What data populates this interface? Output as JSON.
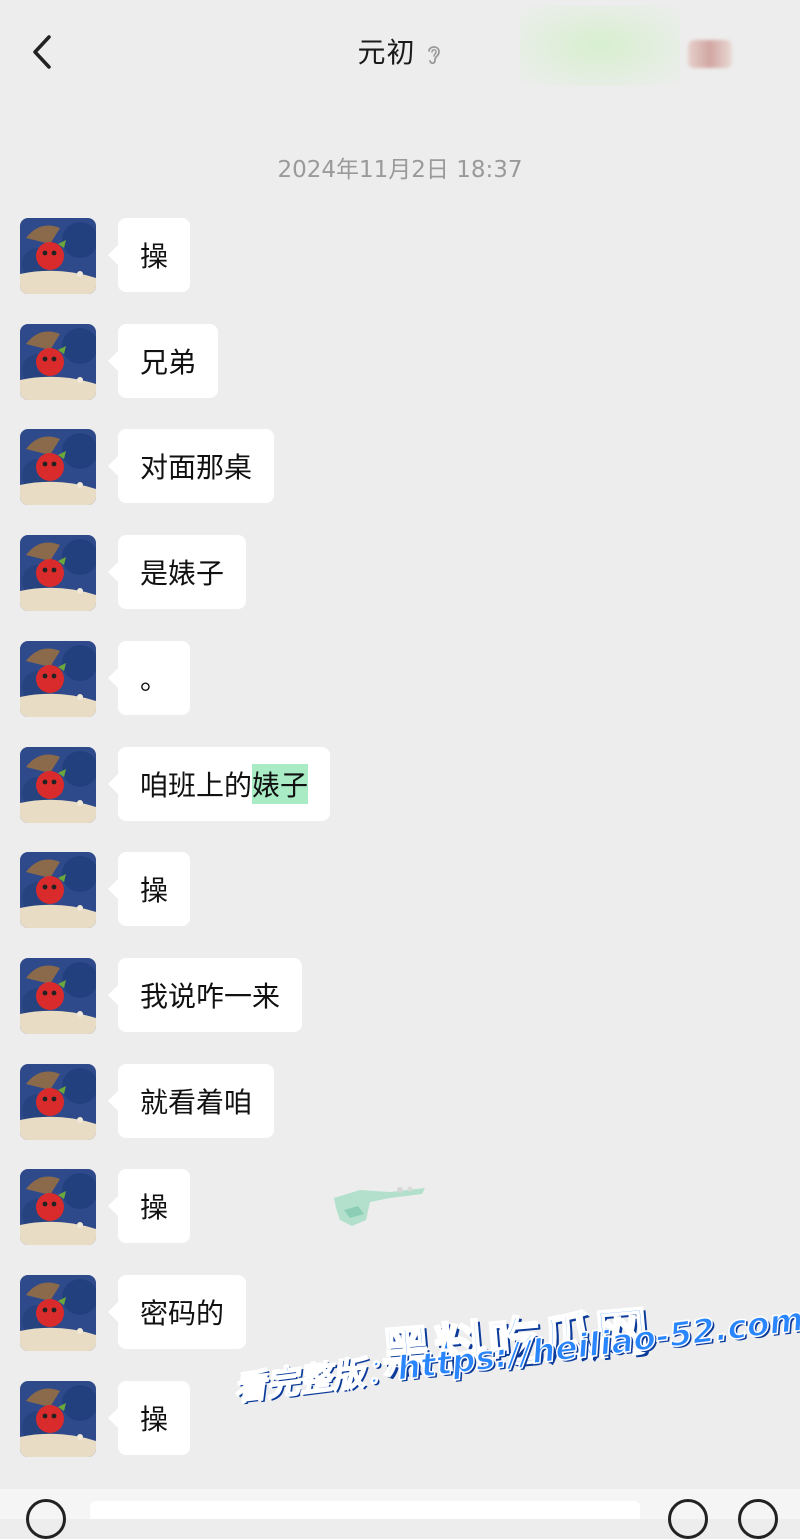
{
  "header": {
    "back_icon": "chevron-left-icon",
    "title": "元初",
    "ear_icon": "ear-icon"
  },
  "timestamp": "2024年11月2日 18:37",
  "messages": [
    {
      "text": "操"
    },
    {
      "text": "兄弟"
    },
    {
      "text": "对面那桌"
    },
    {
      "text": "是婊子"
    },
    {
      "text": "。"
    },
    {
      "text": "咱班上的",
      "highlight": "婊子"
    },
    {
      "text": "操"
    },
    {
      "text": "我说咋一来"
    },
    {
      "text": "就看着咱"
    },
    {
      "text": "操"
    },
    {
      "text": "密码的"
    },
    {
      "text": "操"
    }
  ],
  "watermark": {
    "line1": "黑料吃瓜网",
    "line2": "看完整版：https://heiliao-52.com"
  },
  "colors": {
    "background": "#ededed",
    "bubble": "#ffffff",
    "highlight": "#a9ebc5",
    "watermark": "#2a86ff"
  }
}
